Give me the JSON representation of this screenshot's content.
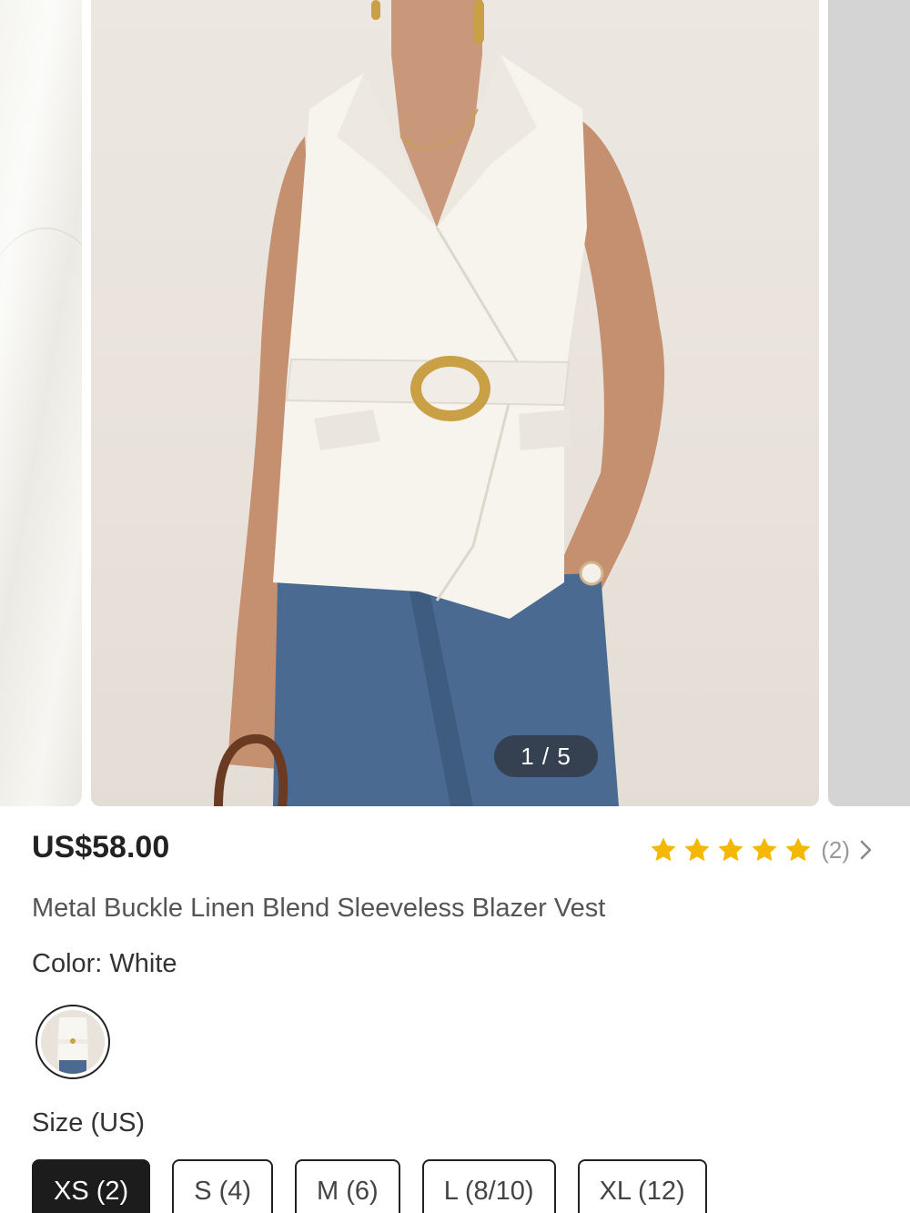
{
  "gallery": {
    "counter": "1 / 5",
    "current_index": 1,
    "total": 5
  },
  "product": {
    "price": "US$58.00",
    "rating_stars": 5,
    "review_count": "(2)",
    "title": "Metal Buckle Linen Blend Sleeveless Blazer Vest",
    "color_label": "Color:",
    "color_value": "White",
    "size_label": "Size (US)",
    "sizes": [
      {
        "label": "XS (2)",
        "selected": true
      },
      {
        "label": "S (4)",
        "selected": false
      },
      {
        "label": "M (6)",
        "selected": false
      },
      {
        "label": "L (8/10)",
        "selected": false
      },
      {
        "label": "XL (12)",
        "selected": false
      }
    ]
  },
  "icons": {
    "star": "star-icon",
    "chevron": "chevron-right-icon"
  },
  "colors": {
    "star": "#F5B800",
    "selected_size_bg": "#1C1C1C",
    "text_primary": "#222222",
    "text_secondary": "#555555",
    "text_muted": "#999999"
  }
}
